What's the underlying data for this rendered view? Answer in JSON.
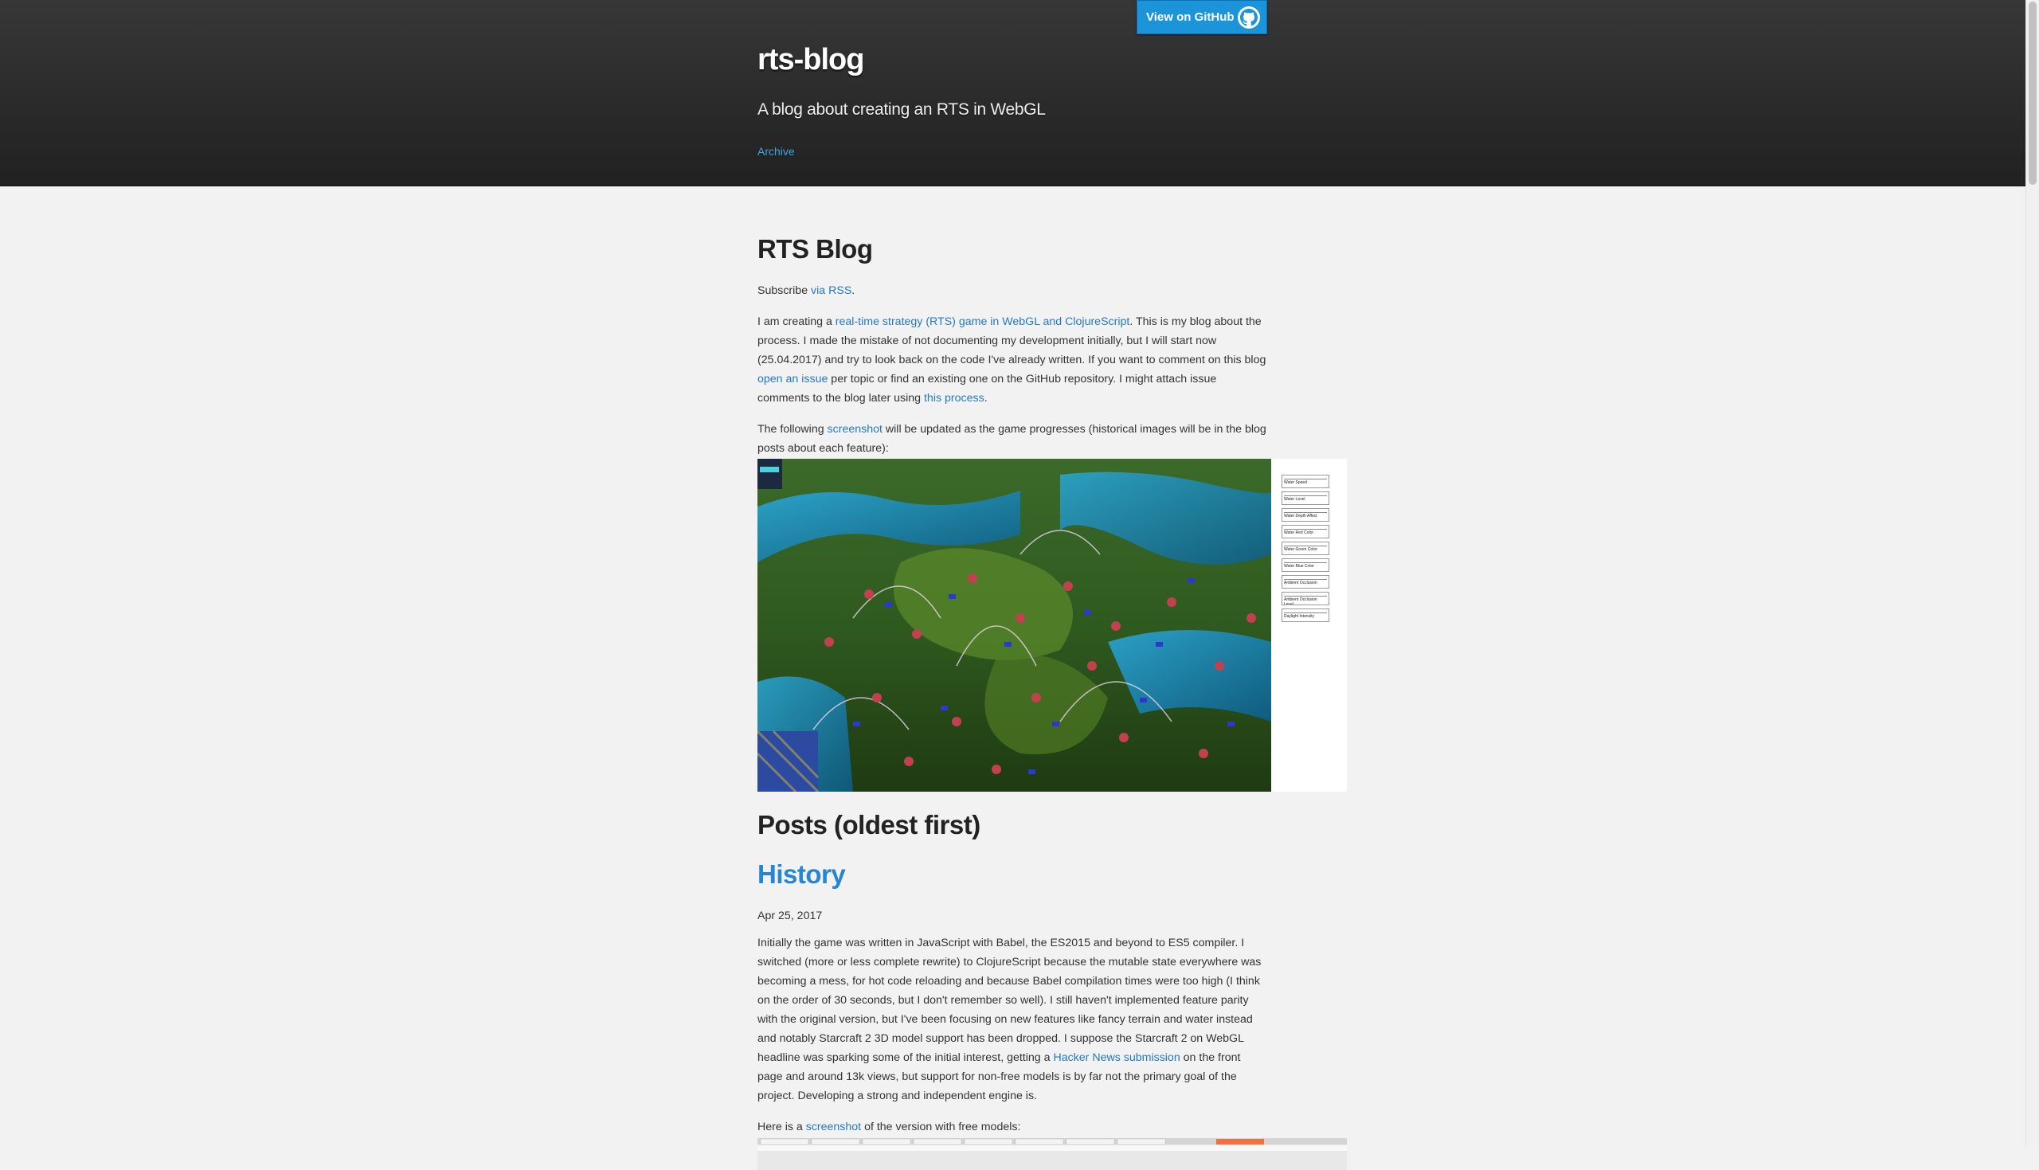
{
  "header": {
    "github_button": "View on GitHub",
    "title": "rts-blog",
    "tagline": "A blog about creating an RTS in WebGL",
    "nav_archive": "Archive"
  },
  "main": {
    "page_title": "RTS Blog",
    "subscribe_prefix": "Subscribe ",
    "subscribe_link": "via RSS",
    "subscribe_suffix": ".",
    "intro": {
      "t1": "I am creating a ",
      "link1": "real-time strategy (RTS) game in WebGL and ClojureScript",
      "t2": ". This is my blog about the process. I made the mistake of not documenting my development initially, but I will start now (25.04.2017) and try to look back on the code I've already written. If you want to comment on this blog ",
      "link2": "open an issue",
      "t3": " per topic or find an existing one on the GitHub repository. I might attach issue comments to the blog later using ",
      "link3": "this process",
      "t4": "."
    },
    "following": {
      "t1": "The following ",
      "link": "screenshot",
      "t2": " will be updated as the game progresses (historical images will be in the blog posts about each feature):"
    },
    "hero_panel_labels": [
      "Water Speed",
      "Water Level",
      "Water Depth Affect",
      "Water Red Color",
      "Water Green Color",
      "Water Blue Color",
      "Ambient Occlusion",
      "Ambient Occlusion Level",
      "Daylight Intensity"
    ],
    "posts_title": "Posts (oldest first)",
    "post": {
      "title": "History",
      "date": "Apr 25, 2017",
      "body_t1": "Initially the game was written in JavaScript with Babel, the ES2015 and beyond to ES5 compiler. I switched (more or less complete rewrite) to ClojureScript because the mutable state everywhere was becoming a mess, for hot code reloading and because Babel compilation times were too high (I think on the order of 30 seconds, but I don't remember so well). I still haven't implemented feature parity with the original version, but I've been focusing on new features like fancy terrain and water instead and notably Starcraft 2 3D model support has been dropped. I suppose the Starcraft 2 on WebGL headline was sparking some of the initial interest, getting a ",
      "body_link": "Hacker News submission",
      "body_t2": " on the front page and around 13k views, but support for non-free models is by far not the primary goal of the project. Developing a strong and independent engine is.",
      "shot_t1": "Here is a ",
      "shot_link": "screenshot",
      "shot_t2": " of the version with free models:"
    }
  },
  "colors": {
    "header_bg": "#2b2b2b",
    "github_blue": "#1c94d9",
    "link": "#2479c4",
    "page_bg": "#f2f2f2"
  }
}
